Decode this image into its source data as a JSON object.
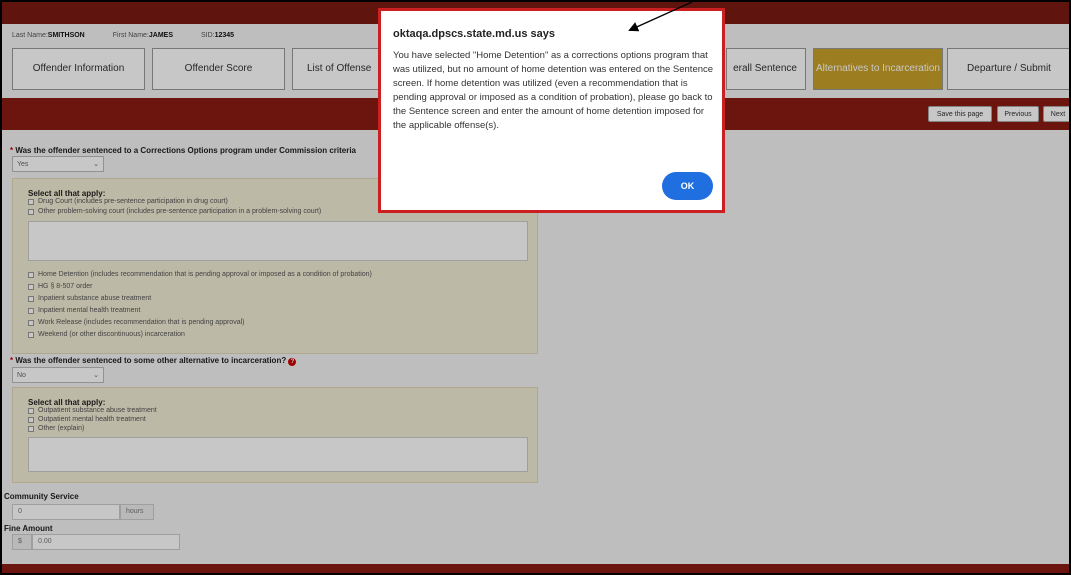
{
  "info_bar": {
    "last_name_label": "Last Name:",
    "last_name": "SMITHSON",
    "first_name_label": "First Name:",
    "first_name": "JAMES",
    "sid_label": "SID:",
    "sid": "12345"
  },
  "tabs": [
    {
      "label": "Offender Information"
    },
    {
      "label": "Offender Score"
    },
    {
      "label": "List of Offense"
    },
    {
      "label": "erall Sentence"
    },
    {
      "label": "Alternatives to Incarceration",
      "active": true
    },
    {
      "label": "Departure / Submit"
    }
  ],
  "toolbar": {
    "save_label": "Save this page",
    "previous_label": "Previous",
    "next_label": "Next"
  },
  "q1": {
    "question": "Was the offender sentenced to a Corrections Options program under Commission criteria",
    "selected": "Yes",
    "select_all_label": "Select all that apply:",
    "options_top": [
      "Drug Court (includes pre-sentence participation in drug court)",
      "Other problem-solving court (includes pre-sentence participation in a problem-solving court)"
    ],
    "options_bottom": [
      "Home Detention (includes recommendation that is pending approval or imposed as a condition of probation)",
      "HG § 8-507 order",
      "Inpatient substance abuse treatment",
      "Inpatient mental health treatment",
      "Work Release (includes recommendation that is pending approval)",
      "Weekend (or other discontinuous) incarceration"
    ]
  },
  "q2": {
    "question": "Was the offender sentenced to some other alternative to incarceration?",
    "selected": "No",
    "select_all_label": "Select all that apply:",
    "options": [
      "Outpatient substance abuse treatment",
      "Outpatient mental health treatment",
      "Other (explain)"
    ]
  },
  "community_service": {
    "label": "Community Service",
    "value": "0",
    "unit": "hours"
  },
  "fine_amount": {
    "label": "Fine Amount",
    "currency": "$",
    "value": "0.00"
  },
  "dialog": {
    "title": "oktaqa.dpscs.state.md.us says",
    "message": "You have selected \"Home Detention\" as a corrections options program that was utilized, but no amount of home detention was entered on the Sentence screen. If home detention was utilized (even a recommendation that is pending approval or imposed as a condition of probation), please go back to the Sentence screen and enter the amount of home detention imposed for the applicable offense(s).",
    "ok_label": "OK"
  },
  "colors": {
    "header_red": "#8b1c12",
    "active_tab": "#c8a02a",
    "dialog_border": "#cc1f1f",
    "ok_button": "#1f6fe0",
    "panel_bg": "#f3edd6"
  }
}
